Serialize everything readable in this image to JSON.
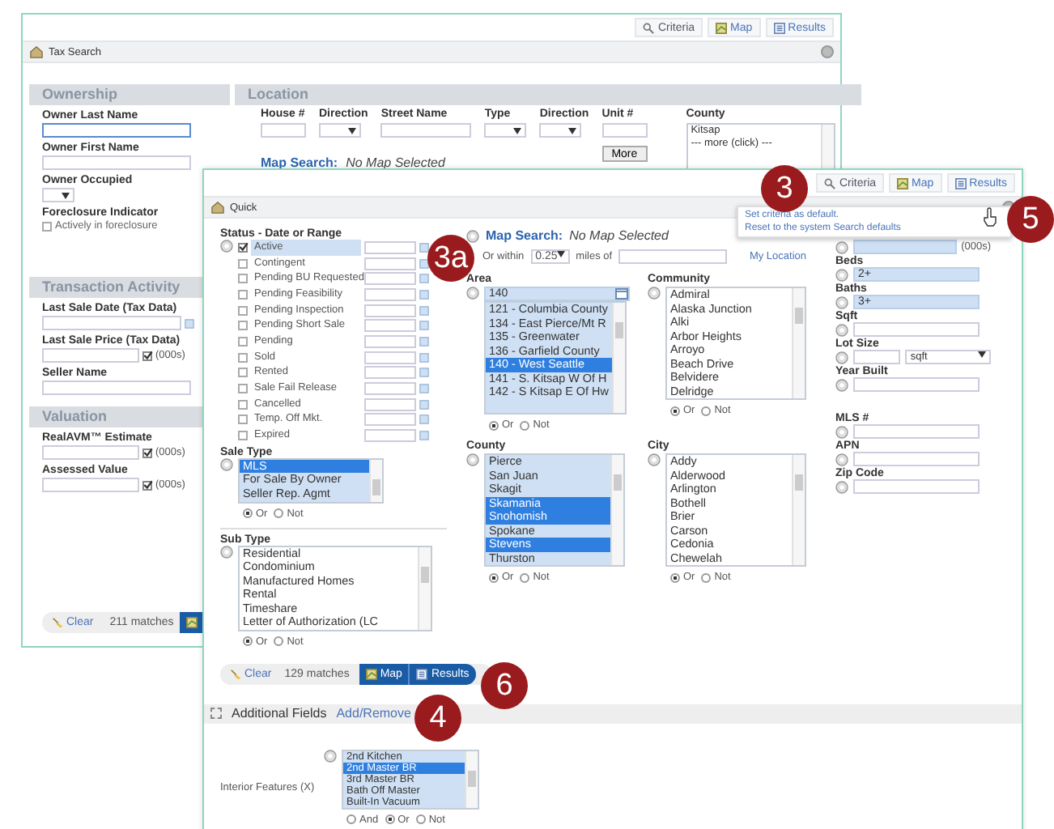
{
  "back_window": {
    "toolbar": [
      {
        "kind": "criteria",
        "label": "Criteria"
      },
      {
        "kind": "map",
        "label": "Map"
      },
      {
        "kind": "results",
        "label": "Results"
      }
    ],
    "title": "Tax Search",
    "sections": [
      {
        "heading": "Ownership",
        "fields": [
          {
            "kind": "text",
            "label": "Owner Last Name",
            "focused": true
          },
          {
            "kind": "text",
            "label": "Owner First Name",
            "focused": false
          },
          {
            "kind": "select",
            "label": "Owner Occupied"
          },
          {
            "kind": "checkbox",
            "label": "Foreclosure Indicator",
            "option": "Actively in foreclosure",
            "checked": false
          }
        ]
      },
      {
        "heading": "Transaction Activity",
        "fields": [
          {
            "kind": "date",
            "label": "Last Sale Date (Tax Data)"
          },
          {
            "kind": "amount",
            "label": "Last Sale Price (Tax Data)",
            "unit": "(000s)",
            "checked": true
          },
          {
            "kind": "text",
            "label": "Seller Name",
            "focused": false
          }
        ]
      },
      {
        "heading": "Valuation",
        "fields": [
          {
            "kind": "amount",
            "label": "RealAVM™ Estimate",
            "unit": "(000s)",
            "checked": true
          },
          {
            "kind": "amount",
            "label": "Assessed Value",
            "unit": "(000s)",
            "checked": true
          }
        ]
      }
    ],
    "location": {
      "heading": "Location",
      "columns": [
        {
          "label": "House #",
          "kind": "text"
        },
        {
          "label": "Direction",
          "kind": "select"
        },
        {
          "label": "Street Name",
          "kind": "text"
        },
        {
          "label": "Type",
          "kind": "select"
        },
        {
          "label": "Direction",
          "kind": "select"
        },
        {
          "label": "Unit #",
          "kind": "text"
        }
      ],
      "more_button": "More",
      "map_search_link": "Map Search:",
      "map_search_status": "No Map Selected",
      "county": {
        "label": "County",
        "options": [
          "Kitsap",
          "--- more (click) ---"
        ]
      }
    },
    "footer": {
      "clear": "Clear",
      "matches": "211 matches"
    }
  },
  "front_window": {
    "toolbar": [
      {
        "kind": "criteria",
        "label": "Criteria"
      },
      {
        "kind": "map",
        "label": "Map"
      },
      {
        "kind": "results",
        "label": "Results"
      }
    ],
    "title": "Quick",
    "menu": [
      "Set criteria as default.",
      "Reset to the system Search defaults"
    ],
    "status": {
      "label": "Status - Date or Range",
      "items": [
        {
          "label": "Active",
          "checked": true
        },
        {
          "label": "Contingent",
          "checked": false
        },
        {
          "label": "Pending BU Requested",
          "checked": false
        },
        {
          "label": "Pending Feasibility",
          "checked": false
        },
        {
          "label": "Pending Inspection",
          "checked": false
        },
        {
          "label": "Pending Short Sale",
          "checked": false
        },
        {
          "label": "Pending",
          "checked": false
        },
        {
          "label": "Sold",
          "checked": false
        },
        {
          "label": "Rented",
          "checked": false
        },
        {
          "label": "Sale Fail Release",
          "checked": false
        },
        {
          "label": "Cancelled",
          "checked": false
        },
        {
          "label": "Temp. Off Mkt.",
          "checked": false
        },
        {
          "label": "Expired",
          "checked": false
        }
      ]
    },
    "sale_type": {
      "label": "Sale Type",
      "options": [
        {
          "label": "MLS",
          "selected": true
        },
        {
          "label": "For Sale By Owner",
          "selected": false
        },
        {
          "label": "Seller Rep. Agmt",
          "selected": false
        }
      ],
      "radios": [
        {
          "label": "Or",
          "selected": true
        },
        {
          "label": "Not",
          "selected": false
        }
      ]
    },
    "sub_type": {
      "label": "Sub Type",
      "options": [
        {
          "label": "Residential",
          "selected": false
        },
        {
          "label": "Condominium",
          "selected": false
        },
        {
          "label": "Manufactured Homes",
          "selected": false
        },
        {
          "label": "Rental",
          "selected": false
        },
        {
          "label": "Timeshare",
          "selected": false
        },
        {
          "label": "Letter of Authorization (LC",
          "selected": false
        }
      ],
      "radios": [
        {
          "label": "Or",
          "selected": true
        },
        {
          "label": "Not",
          "selected": false
        }
      ]
    },
    "footer": {
      "clear": "Clear",
      "matches": "129 matches",
      "map": "Map",
      "results": "Results"
    },
    "map_search": {
      "link": "Map Search:",
      "status": "No Map Selected",
      "within_label": "Or within",
      "distance": "0.25",
      "miles_label": "miles of",
      "location_link": "My Location"
    },
    "lists": [
      {
        "label": "Area",
        "value": "140",
        "options": [
          {
            "label": "121 - Columbia County",
            "selected": false
          },
          {
            "label": "134 - East Pierce/Mt R",
            "selected": false
          },
          {
            "label": "135 - Greenwater",
            "selected": false
          },
          {
            "label": "136 - Garfield County",
            "selected": false
          },
          {
            "label": "140 - West Seattle",
            "selected": true
          },
          {
            "label": "141 - S. Kitsap W Of H",
            "selected": false
          },
          {
            "label": "142 - S Kitsap E Of Hw",
            "selected": false
          }
        ],
        "radios": [
          {
            "label": "Or",
            "selected": true
          },
          {
            "label": "Not",
            "selected": false
          }
        ]
      },
      {
        "label": "Community",
        "options": [
          {
            "label": "Admiral",
            "selected": false
          },
          {
            "label": "Alaska Junction",
            "selected": false
          },
          {
            "label": "Alki",
            "selected": false
          },
          {
            "label": "Arbor Heights",
            "selected": false
          },
          {
            "label": "Arroyo",
            "selected": false
          },
          {
            "label": "Beach Drive",
            "selected": false
          },
          {
            "label": "Belvidere",
            "selected": false
          },
          {
            "label": "Delridge",
            "selected": false
          }
        ],
        "radios": [
          {
            "label": "Or",
            "selected": true
          },
          {
            "label": "Not",
            "selected": false
          }
        ]
      },
      {
        "label": "County",
        "options": [
          {
            "label": "Pierce",
            "selected": false
          },
          {
            "label": "San Juan",
            "selected": false
          },
          {
            "label": "Skagit",
            "selected": false
          },
          {
            "label": "Skamania",
            "selected": true
          },
          {
            "label": "Snohomish",
            "selected": true
          },
          {
            "label": "Spokane",
            "selected": false
          },
          {
            "label": "Stevens",
            "selected": true
          },
          {
            "label": "Thurston",
            "selected": false
          }
        ],
        "radios": [
          {
            "label": "Or",
            "selected": true
          },
          {
            "label": "Not",
            "selected": false
          }
        ]
      },
      {
        "label": "City",
        "options": [
          {
            "label": "Addy",
            "selected": false
          },
          {
            "label": "Alderwood",
            "selected": false
          },
          {
            "label": "Arlington",
            "selected": false
          },
          {
            "label": "Bothell",
            "selected": false
          },
          {
            "label": "Brier",
            "selected": false
          },
          {
            "label": "Carson",
            "selected": false
          },
          {
            "label": "Cedonia",
            "selected": false
          },
          {
            "label": "Chewelah",
            "selected": false
          }
        ],
        "radios": [
          {
            "label": "Or",
            "selected": true
          },
          {
            "label": "Not",
            "selected": false
          }
        ]
      }
    ],
    "right_groups": [
      [
        {
          "kind": "amount",
          "unit": "(000s)",
          "filled": true
        },
        {
          "kind": "text",
          "label": "Beds",
          "value": "2+",
          "filled": true
        },
        {
          "kind": "text",
          "label": "Baths",
          "value": "3+",
          "filled": true
        },
        {
          "kind": "text",
          "label": "Sqft",
          "filled": false
        },
        {
          "kind": "unit",
          "label": "Lot Size",
          "unit": "sqft",
          "filled": false
        },
        {
          "kind": "text",
          "label": "Year Built",
          "filled": false
        }
      ],
      [
        {
          "kind": "text",
          "label": "MLS #",
          "filled": false
        },
        {
          "kind": "text",
          "label": "APN",
          "filled": false
        },
        {
          "kind": "text",
          "label": "Zip Code",
          "filled": false
        }
      ]
    ],
    "additional": {
      "heading": "Additional Fields",
      "link": "Add/Remove",
      "fields": [
        {
          "label": "Interior Features (X)",
          "options": [
            {
              "label": "2nd Kitchen",
              "selected": false
            },
            {
              "label": "2nd Master BR",
              "selected": true
            },
            {
              "label": "3rd Master BR",
              "selected": false
            },
            {
              "label": "Bath Off Master",
              "selected": false
            },
            {
              "label": "Built-In Vacuum",
              "selected": false
            }
          ],
          "radios": [
            {
              "label": "And",
              "selected": false
            },
            {
              "label": "Or",
              "selected": true
            },
            {
              "label": "Not",
              "selected": false
            }
          ]
        }
      ]
    }
  },
  "badges": [
    {
      "label": "3"
    },
    {
      "label": "3a"
    },
    {
      "label": "5"
    },
    {
      "label": "6"
    },
    {
      "label": "4"
    }
  ]
}
